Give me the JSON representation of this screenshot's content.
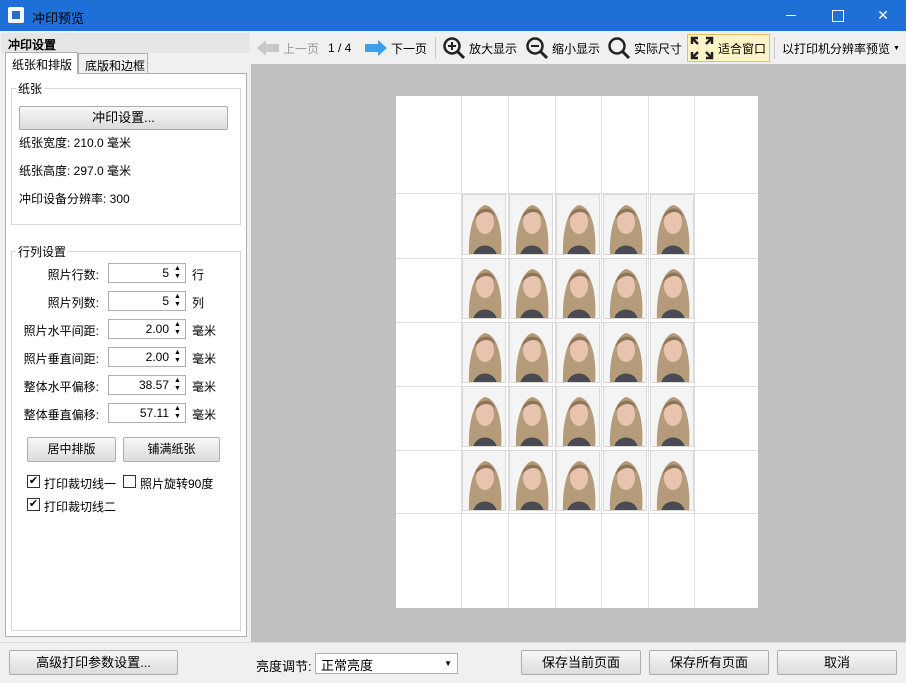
{
  "window": {
    "title": "冲印预览",
    "app_icon": "print-preview-app-icon",
    "controls": {
      "minimize": "minimize-icon",
      "maximize": "maximize-icon",
      "close": "close-icon"
    }
  },
  "left_panel": {
    "header": "冲印设置",
    "tabs": [
      "纸张和排版",
      "底版和边框"
    ],
    "active_tab": 0,
    "paper_group": {
      "title": "纸张",
      "settings_button": "冲印设置...",
      "width": "纸张宽度: 210.0 毫米",
      "height": "纸张高度: 297.0 毫米",
      "dpi": "冲印设备分辨率: 300"
    },
    "grid_group": {
      "title": "行列设置",
      "fields": [
        {
          "label": "照片行数:",
          "value": "5",
          "unit": "行"
        },
        {
          "label": "照片列数:",
          "value": "5",
          "unit": "列"
        },
        {
          "label": "照片水平间距:",
          "value": "2.00",
          "unit": "毫米"
        },
        {
          "label": "照片垂直间距:",
          "value": "2.00",
          "unit": "毫米"
        },
        {
          "label": "整体水平偏移:",
          "value": "38.57",
          "unit": "毫米"
        },
        {
          "label": "整体垂直偏移:",
          "value": "57.11",
          "unit": "毫米"
        }
      ],
      "center_button": "居中排版",
      "fill_button": "铺满纸张",
      "checkboxes": [
        {
          "label": "打印裁切线一",
          "checked": true
        },
        {
          "label": "照片旋转90度",
          "checked": false
        },
        {
          "label": "打印裁切线二",
          "checked": true
        }
      ]
    }
  },
  "toolbar": {
    "prev": {
      "label": "上一页",
      "icon": "arrow-left-icon",
      "enabled": false
    },
    "page_indicator": "1 / 4",
    "next": {
      "label": "下一页",
      "icon": "arrow-right-icon",
      "enabled": true
    },
    "zoom_in": {
      "label": "放大显示",
      "icon": "zoom-in-icon"
    },
    "zoom_out": {
      "label": "缩小显示",
      "icon": "zoom-out-icon"
    },
    "actual_size": {
      "label": "实际尺寸",
      "icon": "magnifier-icon"
    },
    "fit_window": {
      "label": "适合窗口",
      "icon": "fit-window-icon",
      "active": true
    },
    "printer_preview": {
      "label": "以打印机分辨率预览",
      "icon": "dropdown-caret-icon"
    }
  },
  "preview": {
    "photo_rows": 5,
    "photo_cols": 5,
    "photo_icon": "portrait-photo",
    "colors": {
      "canvas_bg": "#c0c0c0",
      "page_bg": "#ffffff",
      "cut_line": "#dedede"
    }
  },
  "bottom": {
    "advanced_button": "高级打印参数设置...",
    "brightness_label": "亮度调节:",
    "brightness_value": "正常亮度",
    "save_current": "保存当前页面",
    "save_all": "保存所有页面",
    "cancel": "取消"
  },
  "colors": {
    "titlebar": "#1e6fd6",
    "accent_blue": "#3aa0e8",
    "active_tool_bg": "#fdf4c8"
  }
}
